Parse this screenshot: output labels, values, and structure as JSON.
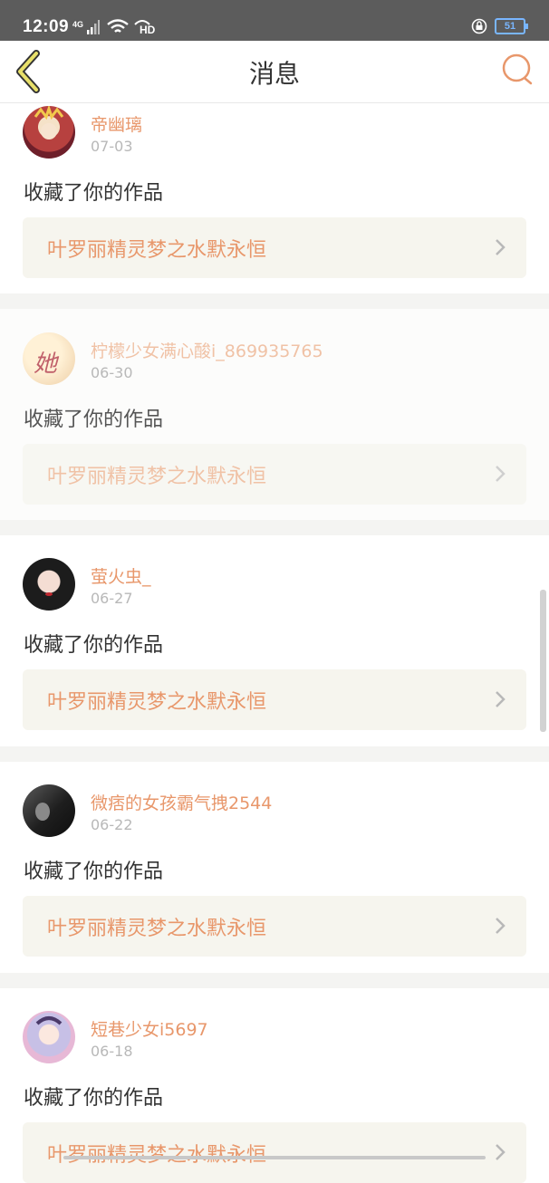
{
  "status_bar": {
    "time": "12:09",
    "network": "4G",
    "hd_label": "HD",
    "battery": "51"
  },
  "nav": {
    "title": "消息",
    "back_icon": "chevron-left-icon",
    "search_icon": "search-icon",
    "accent_color": "#e8976b"
  },
  "messages": [
    {
      "name": "帝幽璃",
      "date": "07-03",
      "action": "收藏了你的作品",
      "work_title": "叶罗丽精灵梦之水默永恒"
    },
    {
      "name": "柠檬少女满心酸i_869935765",
      "date": "06-30",
      "action": "收藏了你的作品",
      "work_title": "叶罗丽精灵梦之水默永恒",
      "avatar_text": "她"
    },
    {
      "name": "萤火虫_",
      "date": "06-27",
      "action": "收藏了你的作品",
      "work_title": "叶罗丽精灵梦之水默永恒"
    },
    {
      "name": "微痞的女孩霸气拽2544",
      "date": "06-22",
      "action": "收藏了你的作品",
      "work_title": "叶罗丽精灵梦之水默永恒"
    },
    {
      "name": "短巷少女i5697",
      "date": "06-18",
      "action": "收藏了你的作品",
      "work_title": "叶罗丽精灵梦之水默永恒"
    }
  ]
}
